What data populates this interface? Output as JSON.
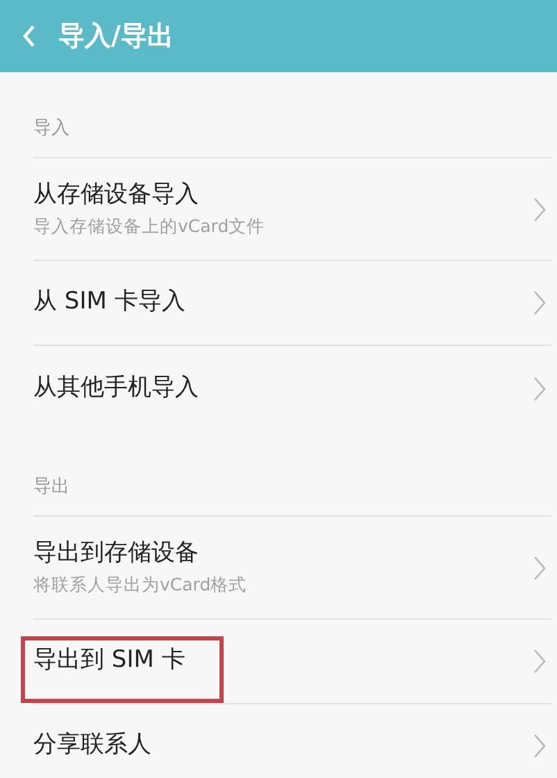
{
  "header": {
    "title": "导入/导出"
  },
  "sections": [
    {
      "title": "导入",
      "items": [
        {
          "title": "从存储设备导入",
          "subtitle": "导入存储设备上的vCard文件",
          "highlighted": false
        },
        {
          "title": "从 SIM 卡导入",
          "highlighted": false
        },
        {
          "title": "从其他手机导入",
          "highlighted": false
        }
      ]
    },
    {
      "title": "导出",
      "items": [
        {
          "title": "导出到存储设备",
          "subtitle": "将联系人导出为vCard格式",
          "highlighted": false
        },
        {
          "title": "导出到 SIM 卡",
          "highlighted": true
        },
        {
          "title": "分享联系人",
          "highlighted": false
        }
      ]
    }
  ]
}
